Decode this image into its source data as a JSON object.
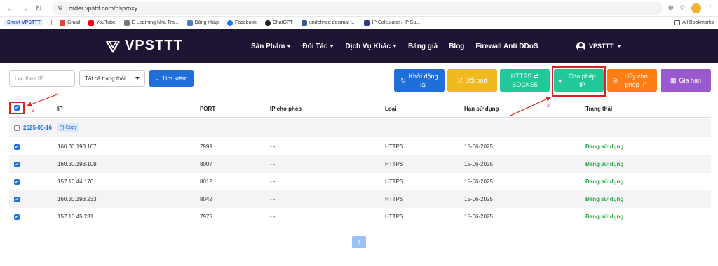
{
  "browser": {
    "url": "order.vpsttt.com/dsproxy",
    "bookmarks": [
      {
        "label": "Sheet VPSTTT",
        "color": "#1a56c4"
      },
      {
        "label": "Gmail",
        "color": "#ea4335"
      },
      {
        "label": "YouTube",
        "color": "#ff0000"
      },
      {
        "label": "E-Learning Nha Tra...",
        "color": "#7a7a7a"
      },
      {
        "label": "Đăng nhập",
        "color": "#4a7bd0"
      },
      {
        "label": "Facebook",
        "color": "#1877f2"
      },
      {
        "label": "ChatGPT",
        "color": "#222222"
      },
      {
        "label": "undefined decimal t...",
        "color": "#3b5a8a"
      },
      {
        "label": "IP Calculator / IP Su...",
        "color": "#2b3a8c"
      }
    ],
    "all_bookmarks": "All Bookmarks"
  },
  "header": {
    "logo": "VPSTTT",
    "nav": [
      {
        "label": "Sản Phẩm",
        "dropdown": true
      },
      {
        "label": "Đối Tác",
        "dropdown": true
      },
      {
        "label": "Dịch Vụ Khác",
        "dropdown": true
      },
      {
        "label": "Bảng giá",
        "dropdown": false
      },
      {
        "label": "Blog",
        "dropdown": false
      },
      {
        "label": "Firewall Anti DDoS",
        "dropdown": false
      }
    ],
    "user": "VPSTTT"
  },
  "toolbar": {
    "filter_placeholder": "Lọc theo IP",
    "status_select": "Tất cả trạng thái",
    "search": "Tìm kiếm",
    "actions": {
      "restart": "Khởi động lại",
      "change_port": "Đổi port",
      "protocol": "HTTPS ⇄ SOCKS5",
      "allow_ip": "Cho phép IP",
      "deny_ip": "Hủy cho phép IP",
      "renew": "Gia hạn"
    }
  },
  "table": {
    "headers": [
      "IP",
      "PORT",
      "IP cho phép",
      "Loại",
      "Hạn sử dụng",
      "Trạng thái"
    ],
    "group_date": "2025-05-16",
    "copy": "Copy",
    "rows": [
      {
        "ip": "160.30.193.107",
        "port": "7999",
        "allowed": "- -",
        "type": "HTTPS",
        "expiry": "15-06-2025",
        "status": "Đang sử dụng"
      },
      {
        "ip": "160.30.193.109",
        "port": "8007",
        "allowed": "- -",
        "type": "HTTPS",
        "expiry": "15-06-2025",
        "status": "Đang sử dụng"
      },
      {
        "ip": "157.10.44.176",
        "port": "8012",
        "allowed": "- -",
        "type": "HTTPS",
        "expiry": "15-06-2025",
        "status": "Đang sử dụng"
      },
      {
        "ip": "160.30.193.233",
        "port": "8042",
        "allowed": "- -",
        "type": "HTTPS",
        "expiry": "15-06-2025",
        "status": "Đang sử dụng"
      },
      {
        "ip": "157.10.45.231",
        "port": "7975",
        "allowed": "- -",
        "type": "HTTPS",
        "expiry": "15-06-2025",
        "status": "Đang sử dụng"
      }
    ]
  },
  "pagination": {
    "current": "1"
  },
  "annotations": {
    "one": "1",
    "two": "2",
    "color": "#e02020"
  }
}
